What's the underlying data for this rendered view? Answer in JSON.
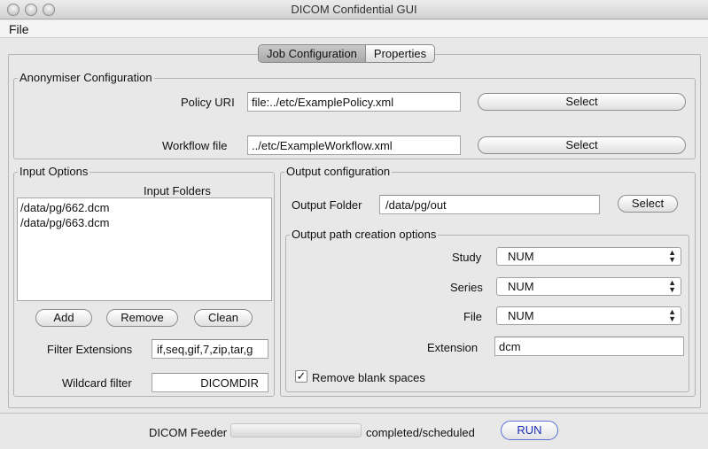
{
  "window": {
    "title": "DICOM Confidential GUI"
  },
  "menu": {
    "file": "File"
  },
  "tabs": [
    {
      "label": "Job Configuration",
      "active": true
    },
    {
      "label": "Properties",
      "active": false
    }
  ],
  "anonymiser": {
    "title": "Anonymiser Configuration",
    "policy_label": "Policy URI",
    "policy_value": "file:../etc/ExamplePolicy.xml",
    "policy_select": "Select",
    "workflow_label": "Workflow file",
    "workflow_value": "../etc/ExampleWorkflow.xml",
    "workflow_select": "Select"
  },
  "input_options": {
    "title": "Input Options",
    "folders_header": "Input Folders",
    "folders": [
      "/data/pg/662.dcm",
      "/data/pg/663.dcm"
    ],
    "add": "Add",
    "remove": "Remove",
    "clean": "Clean",
    "filter_label": "Filter Extensions",
    "filter_value": "if,seq,gif,7,zip,tar,g",
    "wildcard_label": "Wildcard filter",
    "wildcard_value": "DICOMDIR"
  },
  "output": {
    "title": "Output configuration",
    "folder_label": "Output Folder",
    "folder_value": "/data/pg/out",
    "folder_select": "Select",
    "path_options_title": "Output path creation options",
    "study_label": "Study",
    "study_value": "NUM",
    "series_label": "Series",
    "series_value": "NUM",
    "file_label": "File",
    "file_value": "NUM",
    "extension_label": "Extension",
    "extension_value": "dcm",
    "remove_blank_label": "Remove blank spaces",
    "remove_blank_checked": true
  },
  "footer": {
    "feeder_label": "DICOM Feeder",
    "progress": 0,
    "status": "completed/scheduled",
    "run": "RUN"
  }
}
